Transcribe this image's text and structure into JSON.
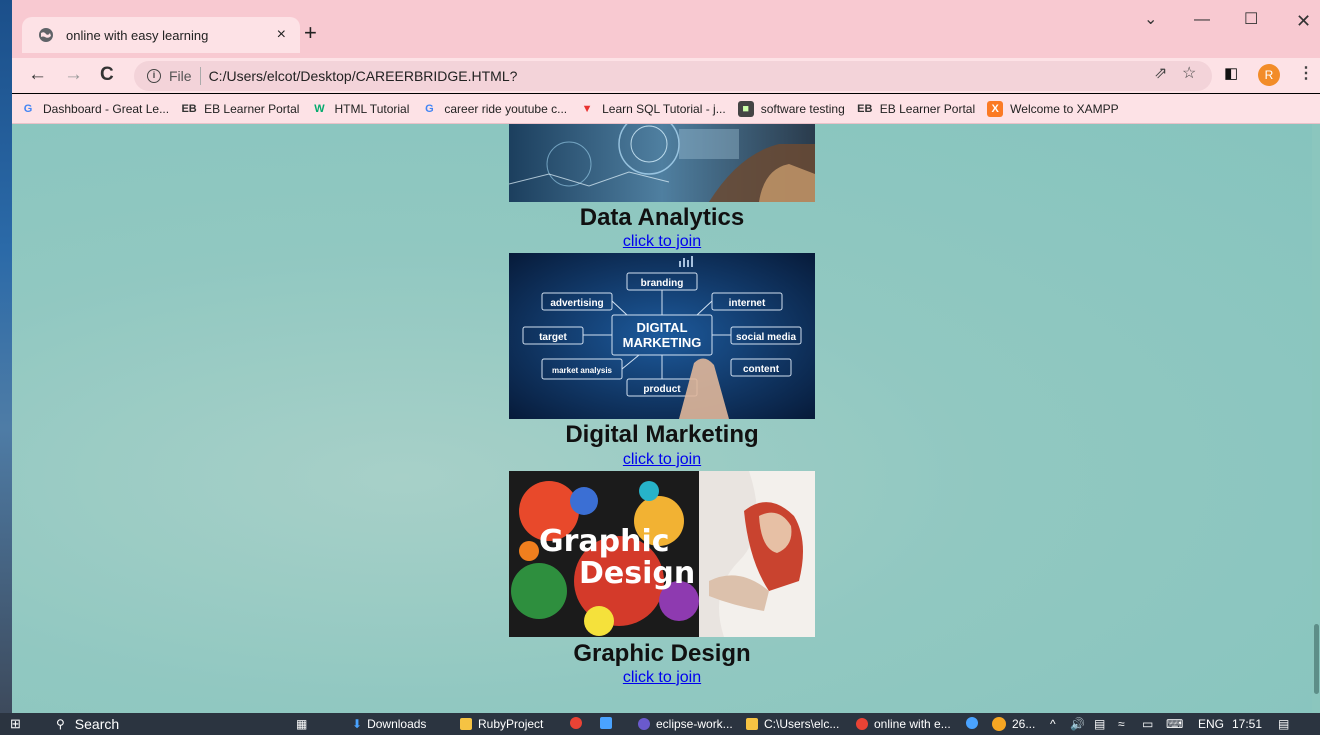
{
  "browser": {
    "tab_title": "online with easy learning",
    "tab_close": "×",
    "new_tab": "+",
    "url_scheme": "File",
    "url": "C:/Users/elcot/Desktop/CAREERBRIDGE.HTML?",
    "profile_initial": "R"
  },
  "bookmarks": [
    {
      "label": "Dashboard - Great Le...",
      "icon": "google-icon"
    },
    {
      "label": "EB Learner Portal",
      "icon": "eb-icon"
    },
    {
      "label": "HTML Tutorial",
      "icon": "w3schools-icon"
    },
    {
      "label": "career ride youtube c...",
      "icon": "google-icon"
    },
    {
      "label": "Learn SQL Tutorial - j...",
      "icon": "tpoint-icon"
    },
    {
      "label": "software testing",
      "icon": "cube-icon"
    },
    {
      "label": "EB Learner Portal",
      "icon": "eb-icon"
    },
    {
      "label": "Welcome to XAMPP",
      "icon": "xampp-icon"
    }
  ],
  "courses": [
    {
      "title": "Data Analytics",
      "link": "click to join",
      "image": "data-analytics-image"
    },
    {
      "title": "Digital Marketing",
      "link": "click to join",
      "image": "digital-marketing-image"
    },
    {
      "title": "Graphic Design",
      "link": "click to join",
      "image": "graphic-design-image"
    }
  ],
  "digital_marketing_words": [
    "branding",
    "advertising",
    "internet",
    "target",
    "DIGITAL",
    "MARKETING",
    "social media",
    "market analysis",
    "content",
    "product"
  ],
  "graphic_design_words": [
    "Graphic",
    "Design"
  ],
  "taskbar": {
    "search": "Search",
    "downloads": "Downloads",
    "ruby": "RubyProject",
    "eclipse": "eclipse-work...",
    "explorer": "C:\\Users\\elc...",
    "chrome": "online with e...",
    "weather": "26...",
    "lang": "ENG",
    "time": "17:51"
  }
}
